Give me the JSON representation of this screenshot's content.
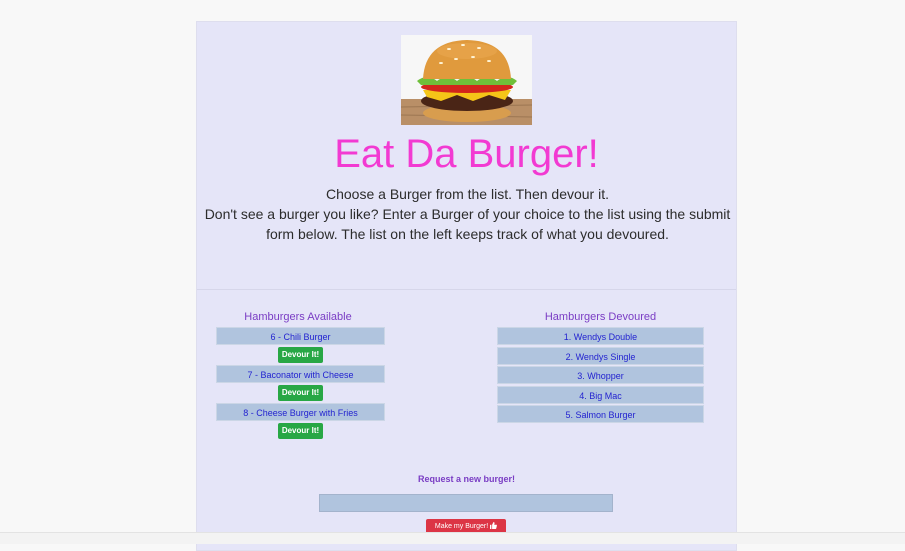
{
  "header": {
    "title": "Eat Da Burger!",
    "intro_line1": "Choose a Burger from the list. Then devour it.",
    "intro_line2": "Don't see a burger you like? Enter a Burger of your choice to the list using the submit form below. The list on the left keeps track of what you devoured."
  },
  "available": {
    "heading": "Hamburgers Available",
    "devour_label": "Devour It!",
    "items": [
      "6 - Chili Burger",
      "7 - Baconator with Cheese",
      "8 - Cheese Burger with Fries"
    ]
  },
  "devoured": {
    "heading": "Hamburgers Devoured",
    "items": [
      "1. Wendys Double",
      "2. Wendys Single",
      "3. Whopper",
      "4. Big Mac",
      "5. Salmon Burger"
    ]
  },
  "request": {
    "label": "Request a new burger!",
    "input_value": "",
    "button_label": "Make my Burger!"
  },
  "icons": {
    "submit_button_icon": "thumbs-up-icon",
    "header_image": "burger-image"
  },
  "colors": {
    "card_bg": "#e5e5f8",
    "title": "#f23ad2",
    "heading": "#7a3dc4",
    "item_bg": "#b0c4de",
    "item_text": "#2323d0",
    "devour_button": "#28a745",
    "submit_button": "#dc3545"
  }
}
